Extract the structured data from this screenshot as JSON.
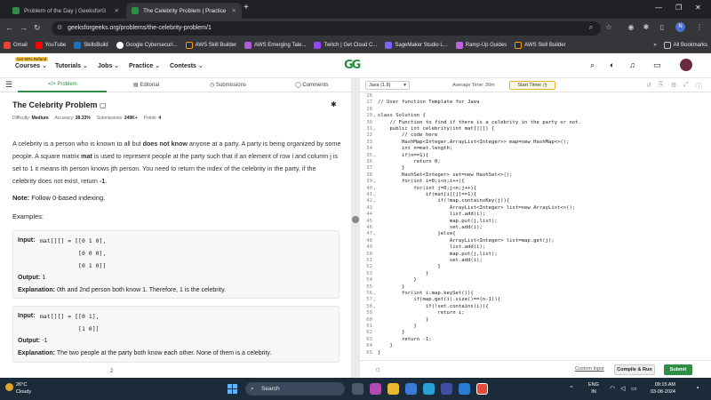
{
  "browser": {
    "tabs": [
      {
        "title": "Problem of the Day | GeeksforG",
        "active": false
      },
      {
        "title": "The Celebrity Problem | Practice",
        "active": true
      }
    ],
    "new_tab": "+",
    "url": "geeksforgeeks.org/problems/the-celebrity-problem/1",
    "profile_initial": "N",
    "bookmarks": [
      "Gmail",
      "YouTube",
      "SkillsBuild",
      "Google Cybersecuri...",
      "AWS Skill Builder",
      "AWS Emerging Tale...",
      "Twitch | Get Cloud C...",
      "SageMaker Studio L...",
      "Ramp-Up Guides",
      "AWS Skill Builder"
    ],
    "all_bookmarks": "All Bookmarks"
  },
  "site": {
    "badge": "Get 90% Refund",
    "menu": [
      "Courses",
      "Tutorials",
      "Jobs",
      "Practice",
      "Contests"
    ],
    "logo": "GG"
  },
  "problem": {
    "tabs": [
      "Problem",
      "Editorial",
      "Submissions",
      "Comments"
    ],
    "title": "The Celebrity Problem",
    "difficulty_label": "Difficulty:",
    "difficulty": "Medium",
    "accuracy_label": "Accuracy:",
    "accuracy": "38.33%",
    "submissions_label": "Submissions:",
    "submissions": "249K+",
    "points_label": "Points:",
    "points": "4",
    "desc_1": "A celebrity is a person who is known to all but ",
    "desc_bold_1": "does not know",
    "desc_2": " anyone at a party. A party is being organized by some people.  A square matrix ",
    "desc_bold_2": "mat",
    "desc_3": " is used to represent people at the party such that if an element of row i and column j is set to 1 it means ith person knows jth person. You need to return the index of the celebrity in the party, if the celebrity does not exist, return ",
    "desc_bold_3": "-1",
    "desc_4": ".",
    "note_label": "Note:",
    "note": " Follow 0-based indexing.",
    "examples_label": "Examples:",
    "example1": {
      "input_label": "Input:",
      "input_lines": [
        "mat[][] = [[0 1 0],",
        "           [0 0 0],",
        "           [0 1 0]]"
      ],
      "output_label": "Output:",
      "output": "1",
      "explanation_label": "Explanation:",
      "explanation": "0th and 2nd person both know 1. Therefore, 1 is the celebrity."
    },
    "example2": {
      "input_label": "Input:",
      "input_lines": [
        "mat[][] = [[0 1],",
        "           [1 0]]"
      ],
      "output_label": "Output:",
      "output": "-1",
      "explanation_label": "Explanation:",
      "explanation": "The two people at the party both know each other. None of them is a celebrity."
    },
    "cut_off_text": "2"
  },
  "editor": {
    "language": "Java (1.8)",
    "avg_time": "Average Time: 30m",
    "start_timer": "Start Timer",
    "custom_input": "Custom Input",
    "compile_run": "Compile & Run",
    "submit": "Submit",
    "lines": [
      {
        "n": "26",
        "f": "",
        "t": ""
      },
      {
        "n": "27",
        "f": "",
        "t": "// User function Template for Java"
      },
      {
        "n": "28",
        "f": "",
        "t": ""
      },
      {
        "n": "29",
        "f": "▾",
        "t": "class Solution {"
      },
      {
        "n": "30",
        "f": "",
        "t": "    // Function to find if there is a celebrity in the party or not."
      },
      {
        "n": "31",
        "f": "▾",
        "t": "    public int celebrity(int mat[][]) {"
      },
      {
        "n": "32",
        "f": "",
        "t": "        // code here"
      },
      {
        "n": "33",
        "f": "",
        "t": "        HashMap<Integer,ArrayList<Integer>> map=new HashMap<>();"
      },
      {
        "n": "34",
        "f": "",
        "t": "        int n=mat.length;"
      },
      {
        "n": "35",
        "f": "▾",
        "t": "        if(n==1){"
      },
      {
        "n": "36",
        "f": "",
        "t": "            return 0;"
      },
      {
        "n": "37",
        "f": "",
        "t": "        }"
      },
      {
        "n": "38",
        "f": "",
        "t": "        HashSet<Integer> set=new HashSet<>();"
      },
      {
        "n": "39",
        "f": "▾",
        "t": "        for(int i=0;i<n;i++){"
      },
      {
        "n": "40",
        "f": "▾",
        "t": "            for(int j=0;j<n;j++){"
      },
      {
        "n": "41",
        "f": "▾",
        "t": "                if(mat[i][j]==1){"
      },
      {
        "n": "42",
        "f": "▾",
        "t": "                    if(!map.containsKey(j)){"
      },
      {
        "n": "43",
        "f": "",
        "t": "                        ArrayList<Integer> list=new ArrayList<>();"
      },
      {
        "n": "44",
        "f": "",
        "t": "                        list.add(i);"
      },
      {
        "n": "45",
        "f": "",
        "t": "                        map.put(j,list);"
      },
      {
        "n": "46",
        "f": "",
        "t": "                        set.add(i);"
      },
      {
        "n": "47",
        "f": "▾",
        "t": "                    }else{"
      },
      {
        "n": "48",
        "f": "",
        "t": "                        ArrayList<Integer> list=map.get(j);"
      },
      {
        "n": "49",
        "f": "",
        "t": "                        list.add(i);"
      },
      {
        "n": "50",
        "f": "",
        "t": "                        map.put(j,list);"
      },
      {
        "n": "51",
        "f": "",
        "t": "                        set.add(i);"
      },
      {
        "n": "52",
        "f": "",
        "t": "                    }"
      },
      {
        "n": "53",
        "f": "",
        "t": "                }"
      },
      {
        "n": "54",
        "f": "",
        "t": "            }"
      },
      {
        "n": "55",
        "f": "",
        "t": "        }"
      },
      {
        "n": "56",
        "f": "▾",
        "t": "        for(int i:map.keySet()){"
      },
      {
        "n": "57",
        "f": "▾",
        "t": "            if(map.get(i).size()==(n-1)){"
      },
      {
        "n": "58",
        "f": "▾",
        "t": "                if(!set.contains(i)){"
      },
      {
        "n": "59",
        "f": "",
        "t": "                    return i;"
      },
      {
        "n": "60",
        "f": "",
        "t": "                }"
      },
      {
        "n": "61",
        "f": "",
        "t": "            }"
      },
      {
        "n": "62",
        "f": "",
        "t": "        }"
      },
      {
        "n": "63",
        "f": "",
        "t": "        return -1;"
      },
      {
        "n": "64",
        "f": "",
        "t": "    }"
      },
      {
        "n": "65",
        "f": "",
        "t": "}"
      }
    ]
  },
  "taskbar": {
    "temperature": "26°C",
    "weather": "Cloudy",
    "search": "Search",
    "lang1": "ENG",
    "lang2": "IN",
    "time": "09:15 AM",
    "date": "03-08-2024"
  },
  "colors": {
    "accent": "#2f8d46",
    "tab_bar": "#202124",
    "taskbar": "#1c2b3a"
  }
}
